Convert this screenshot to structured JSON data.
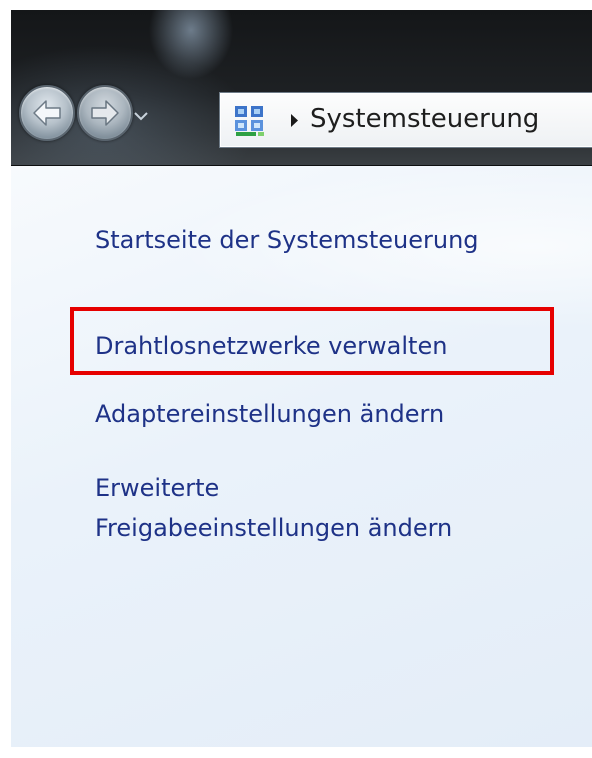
{
  "navigation": {
    "back_icon": "back-arrow-icon",
    "forward_icon": "forward-arrow-icon",
    "history_icon": "chevron-down-icon"
  },
  "address_bar": {
    "location_icon": "control-panel-icon",
    "separator_icon": "breadcrumb-arrow-icon",
    "breadcrumb": "Systemsteuerung"
  },
  "left_pane": {
    "links": [
      "Startseite der Systemsteuerung",
      "Drahtlosnetzwerke verwalten",
      "Adaptereinstellungen ändern",
      "Erweiterte Freigabeeinstellungen ändern"
    ],
    "sharing_link_lines": [
      "Erweiterte",
      "Freigabeeinstellungen ändern"
    ]
  },
  "colors": {
    "link": "#1e3287",
    "highlight": "#e60000",
    "pane_background": "#eaf2fa"
  }
}
